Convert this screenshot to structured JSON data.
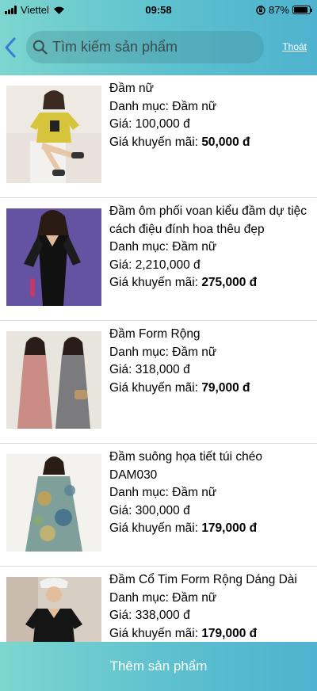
{
  "status": {
    "carrier": "Viettel",
    "time": "09:58",
    "battery": "87%",
    "battery_level": 0.87
  },
  "header": {
    "search_placeholder": "Tìm kiếm sản phẩm",
    "exit_label": "Thoát"
  },
  "products": [
    {
      "name": "Đầm nữ",
      "category": "Danh mục: Đầm nữ",
      "price": "Giá: 100,000 đ",
      "sale_label": "Giá khuyến mãi: ",
      "sale_value": "50,000 đ"
    },
    {
      "name": "Đầm ôm phối voan kiểu đầm dự tiệc cách điệu đính hoa thêu đẹp",
      "category": "Danh mục: Đầm nữ",
      "price": "Giá: 2,210,000 đ",
      "sale_label": "Giá khuyến mãi: ",
      "sale_value": "275,000 đ"
    },
    {
      "name": "Đầm Form Rộng",
      "category": "Danh mục: Đầm nữ",
      "price": "Giá: 318,000 đ",
      "sale_label": "Giá khuyến mãi: ",
      "sale_value": "79,000 đ"
    },
    {
      "name": "Đầm suông họa tiết túi chéo DAM030",
      "category": "Danh mục: Đầm nữ",
      "price": "Giá: 300,000 đ",
      "sale_label": "Giá khuyến mãi: ",
      "sale_value": "179,000 đ"
    },
    {
      "name": "Đầm Cổ Tim Form Rộng Dáng Dài",
      "category": "Danh mục: Đầm nữ",
      "price": "Giá: 338,000 đ",
      "sale_label": "Giá khuyến mãi: ",
      "sale_value": "179,000 đ"
    }
  ],
  "footer": {
    "add_label": "Thêm sản phẩm"
  },
  "colors": {
    "header_start": "#7dd6cf",
    "header_end": "#4fb2cf",
    "back_arrow": "#3a7bd5"
  }
}
